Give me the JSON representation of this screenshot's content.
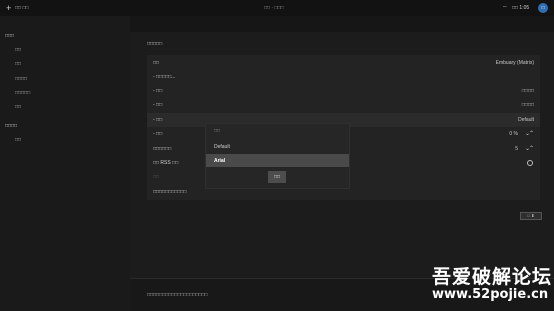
{
  "topbar": {
    "back_symbol": "+",
    "app_title": "□□ □□",
    "center_title": "□□ · □□□",
    "wifi_symbol": "⌔",
    "clock": "□□ 1:05",
    "avatar_letter": "□"
  },
  "sidebar": {
    "section1": "□□□",
    "items1": [
      "□□",
      "□□",
      "□□□□",
      "□□□□□",
      "□□"
    ],
    "section2": "□□□□",
    "items2": [
      "□□"
    ]
  },
  "page": {
    "title": "□□□□□",
    "footer_text": "□□□□□□□□□□□□□□□□□□□□"
  },
  "settings": {
    "rows": [
      {
        "label": "□□",
        "value": "Embuary (Matrix)"
      },
      {
        "label": "- □□□□□...",
        "value": ""
      },
      {
        "label": "- □□",
        "value": "□□□□"
      },
      {
        "label": "- □□",
        "value": "□□□□"
      },
      {
        "label": "- □□",
        "value": "Default"
      },
      {
        "label": "- □□",
        "value": "0 %"
      },
      {
        "label": "□□□□□□",
        "value": "5"
      },
      {
        "label": "□□ RSS □□",
        "value": ""
      },
      {
        "label": "□□",
        "value": ""
      },
      {
        "label": "□□□□□□□□□□□",
        "value": ""
      }
    ],
    "small_button": "□ ⬍"
  },
  "dialog": {
    "title": "□□",
    "options": [
      "Default",
      "Arial"
    ],
    "selected": "Arial",
    "ok_label": "□□"
  },
  "watermark": {
    "line1": "吾爱破解论坛",
    "line2": "www.52pojie.cn"
  }
}
